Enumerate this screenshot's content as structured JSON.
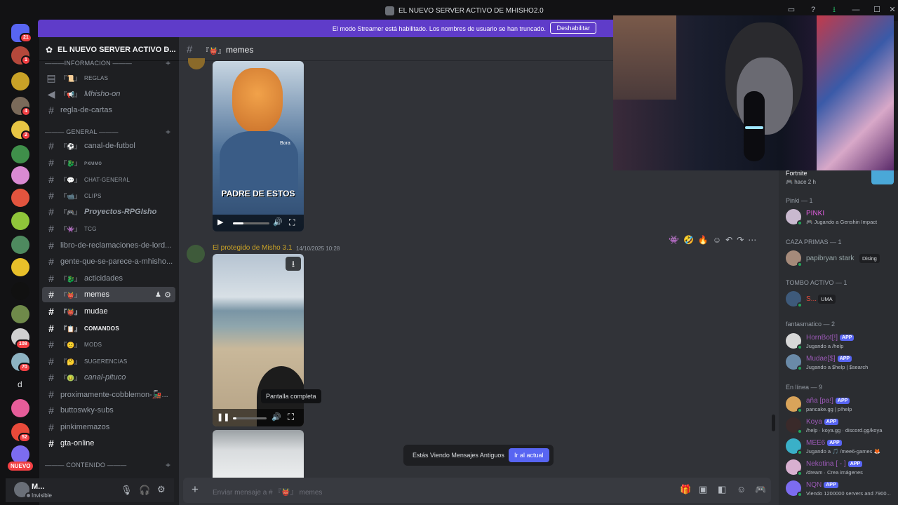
{
  "window": {
    "title": "EL NUEVO SERVER ACTIVO DE MHISHO2.0"
  },
  "banner": {
    "message": "El modo Streamer está habilitado. Los nombres de usuario se han truncado.",
    "button": "Deshabilitar"
  },
  "rail": {
    "badges": [
      "21",
      "1",
      "4",
      "2",
      "108",
      "70",
      "52"
    ],
    "letter": "d",
    "new_label": "NUEVO"
  },
  "server": {
    "name": "EL NUEVO SERVER ACTIVO D..."
  },
  "categories": {
    "info": "———INFORMACION ———",
    "general": "——— GENERAL ———",
    "contenido": "——— CONTENIDO ———"
  },
  "channels": [
    {
      "emoji": "『📜』",
      "name": "REGLAS"
    },
    {
      "emoji": "『📢』",
      "name": "Mhisho-on"
    },
    {
      "emoji": "",
      "name": "regla-de-cartas"
    },
    {
      "emoji": "『⚽』",
      "name": "canal-de-futbol"
    },
    {
      "emoji": "『🐉』",
      "name": "ᴘᴋᴍᴍᴏ"
    },
    {
      "emoji": "『💬』",
      "name": "CHAT-GENERAL"
    },
    {
      "emoji": "『📹』",
      "name": "CLIPS"
    },
    {
      "emoji": "『🎮』",
      "name": "Proyectos-RPGIsho"
    },
    {
      "emoji": "『👾』",
      "name": "TCG"
    },
    {
      "emoji": "",
      "name": "libro-de-reclamaciones-de-lord..."
    },
    {
      "emoji": "",
      "name": "gente-que-se-parece-a-mhisho..."
    },
    {
      "emoji": "『🐉』",
      "name": "acticidades"
    },
    {
      "emoji": "『👹』",
      "name": "memes"
    },
    {
      "emoji": "『👹』",
      "name": "mudae"
    },
    {
      "emoji": "『📋』",
      "name": "COMANDOS"
    },
    {
      "emoji": "『😐』",
      "name": "MODS"
    },
    {
      "emoji": "『🤔』",
      "name": "SUGERENCIAS"
    },
    {
      "emoji": "『🤢』",
      "name": "canal-pituco"
    },
    {
      "emoji": "",
      "name": "proximamente-cobblemon-🚂..."
    },
    {
      "emoji": "",
      "name": "buttoswky-subs"
    },
    {
      "emoji": "",
      "name": "pinkimemazos"
    },
    {
      "emoji": "",
      "name": "gta-online"
    }
  ],
  "user": {
    "name": "M...",
    "status": "Invisible"
  },
  "chat": {
    "channel_name": "memes",
    "channel_emoji": "『👹』",
    "video1_caption": "PADRE DE ESTOS",
    "video1_watermark": "Bora",
    "message": {
      "author": "El protegido de Misho 3.1",
      "timestamp": "14/10/2025 10:28"
    },
    "tooltip": "Pantalla completa",
    "jump_bar": {
      "text": "Estás Viendo Mensajes Antiguos",
      "button": "Ir al actual"
    },
    "composer_placeholder_prefix": "Enviar mensaje a #",
    "composer_channel": "memes"
  },
  "activity": {
    "game": "Fortnite",
    "time": "hace 2 h"
  },
  "members": {
    "groups": [
      {
        "label": "Pinki — 1",
        "members": [
          {
            "name": "PINKI",
            "status": "Jugando a Genshin Impact",
            "color": "#e25ee0"
          }
        ]
      },
      {
        "label": "CAZA PRIMAS — 1",
        "members": [
          {
            "name": "papibryan stark",
            "status": "",
            "tag": "Dising",
            "color": "#95a5a6"
          }
        ]
      },
      {
        "label": "TOMBO ACTIVO — 1",
        "members": [
          {
            "name": "S...",
            "status": "",
            "tag": "UMA",
            "color": "#e74c3c"
          }
        ]
      },
      {
        "label": "fantasmatico — 2",
        "members": [
          {
            "name": "HornBot[!]",
            "status": "Jugando a /help",
            "app": "APP",
            "color": "#9b59b6"
          },
          {
            "name": "Mudae[$]",
            "status": "Jugando a $help | $search",
            "app": "APP",
            "color": "#9b59b6"
          }
        ]
      },
      {
        "label": "En línea — 9",
        "members": [
          {
            "name": "aña [pa!]",
            "status": "pancake.gg | p!help",
            "app": "APP",
            "color": "#9b59b6"
          },
          {
            "name": "Koya",
            "status": "/help · koya.gg · discord.gg/koya",
            "app": "APP",
            "color": "#9b59b6"
          },
          {
            "name": "MEE6",
            "status": "Jugando a 🎵 /mee6-games 🦊",
            "app": "APP",
            "color": "#9b59b6"
          },
          {
            "name": "Nekotina [ - ]",
            "status": "/dream · Crea imágenes",
            "app": "APP",
            "color": "#9b59b6"
          },
          {
            "name": "NQN",
            "status": "Viendo 1200000 servers and 7900...",
            "app": "APP",
            "color": "#9b59b6"
          }
        ]
      }
    ]
  },
  "colors": {
    "accent": "#5865f2",
    "banner": "#5f3cc9",
    "online": "#23a55a",
    "danger": "#f23f43"
  }
}
